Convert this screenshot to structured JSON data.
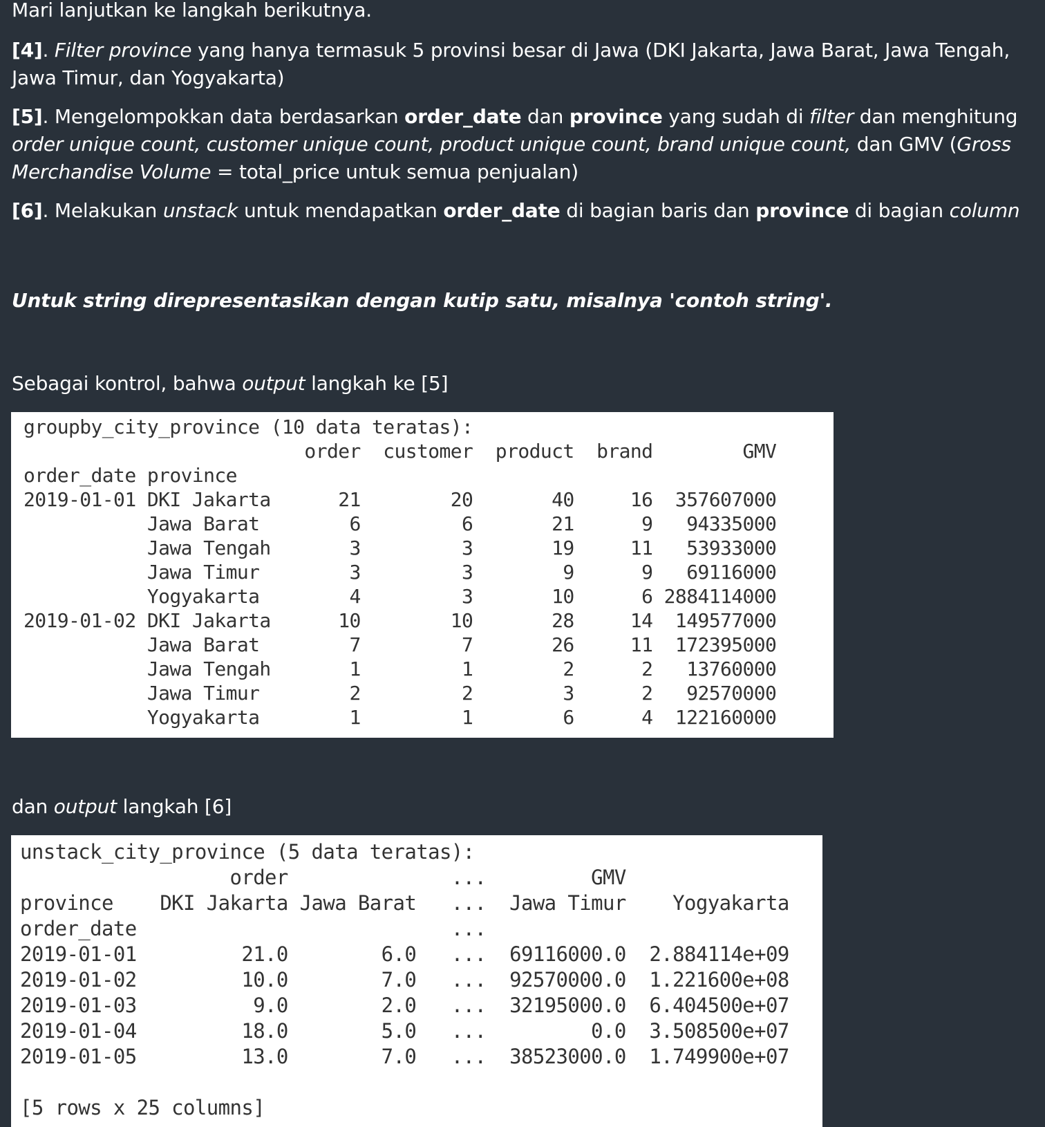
{
  "intro": "Mari lanjutkan ke langkah berikutnya.",
  "step4": {
    "num": "[4]",
    "t1": ". ",
    "i1": "Filter province",
    "t2": " yang hanya termasuk 5 provinsi besar di Jawa (DKI Jakarta, Jawa Barat, Jawa Tengah, Jawa Timur, dan Yogyakarta)"
  },
  "step5": {
    "num": "[5]",
    "t1": ". Mengelompokkan data berdasarkan ",
    "b1": "order_date",
    "t2": " dan ",
    "b2": "province",
    "t3": " yang sudah di ",
    "i1": "filter",
    "t4": " dan menghitung ",
    "i2": "order unique count, customer unique count, product unique count, brand unique count,",
    "t5": " dan GMV (",
    "i3": "Gross Merchandise Volume",
    "t6": " = total_price untuk semua penjualan)"
  },
  "step6": {
    "num": "[6]",
    "t1": ". Melakukan ",
    "i1": "unstack",
    "t2": " untuk mendapatkan ",
    "b1": "order_date",
    "t3": " di bagian baris dan ",
    "b2": "province",
    "t4": " di bagian ",
    "i2": "column"
  },
  "note": "Untuk string direpresentasikan dengan kutip satu, misalnya 'contoh string'.",
  "control5": {
    "t1": "Sebagai kontrol, bahwa ",
    "i1": "output",
    "t2": " langkah ke [5]"
  },
  "control6": {
    "t1": "dan ",
    "i1": "output",
    "t2": " langkah [6]"
  },
  "output5": "groupby_city_province (10 data teratas):\n                         order  customer  product  brand        GMV\norder_date province\n2019-01-01 DKI Jakarta      21        20       40     16  357607000\n           Jawa Barat        6         6       21      9   94335000\n           Jawa Tengah       3         3       19     11   53933000\n           Jawa Timur        3         3        9      9   69116000\n           Yogyakarta        4         3       10      6 2884114000\n2019-01-02 DKI Jakarta      10        10       28     14  149577000\n           Jawa Barat        7         7       26     11  172395000\n           Jawa Tengah       1         1        2      2   13760000\n           Jawa Timur        2         2        3      2   92570000\n           Yogyakarta        1         1        6      4  122160000",
  "output6": "unstack_city_province (5 data teratas):\n                  order              ...         GMV\nprovince    DKI Jakarta Jawa Barat   ...  Jawa Timur    Yogyakarta\norder_date                           ...\n2019-01-01         21.0        6.0   ...  69116000.0  2.884114e+09\n2019-01-02         10.0        7.0   ...  92570000.0  1.221600e+08\n2019-01-03          9.0        2.0   ...  32195000.0  6.404500e+07\n2019-01-04         18.0        5.0   ...         0.0  3.508500e+07\n2019-01-05         13.0        7.0   ...  38523000.0  1.749900e+07\n\n[5 rows x 25 columns]"
}
